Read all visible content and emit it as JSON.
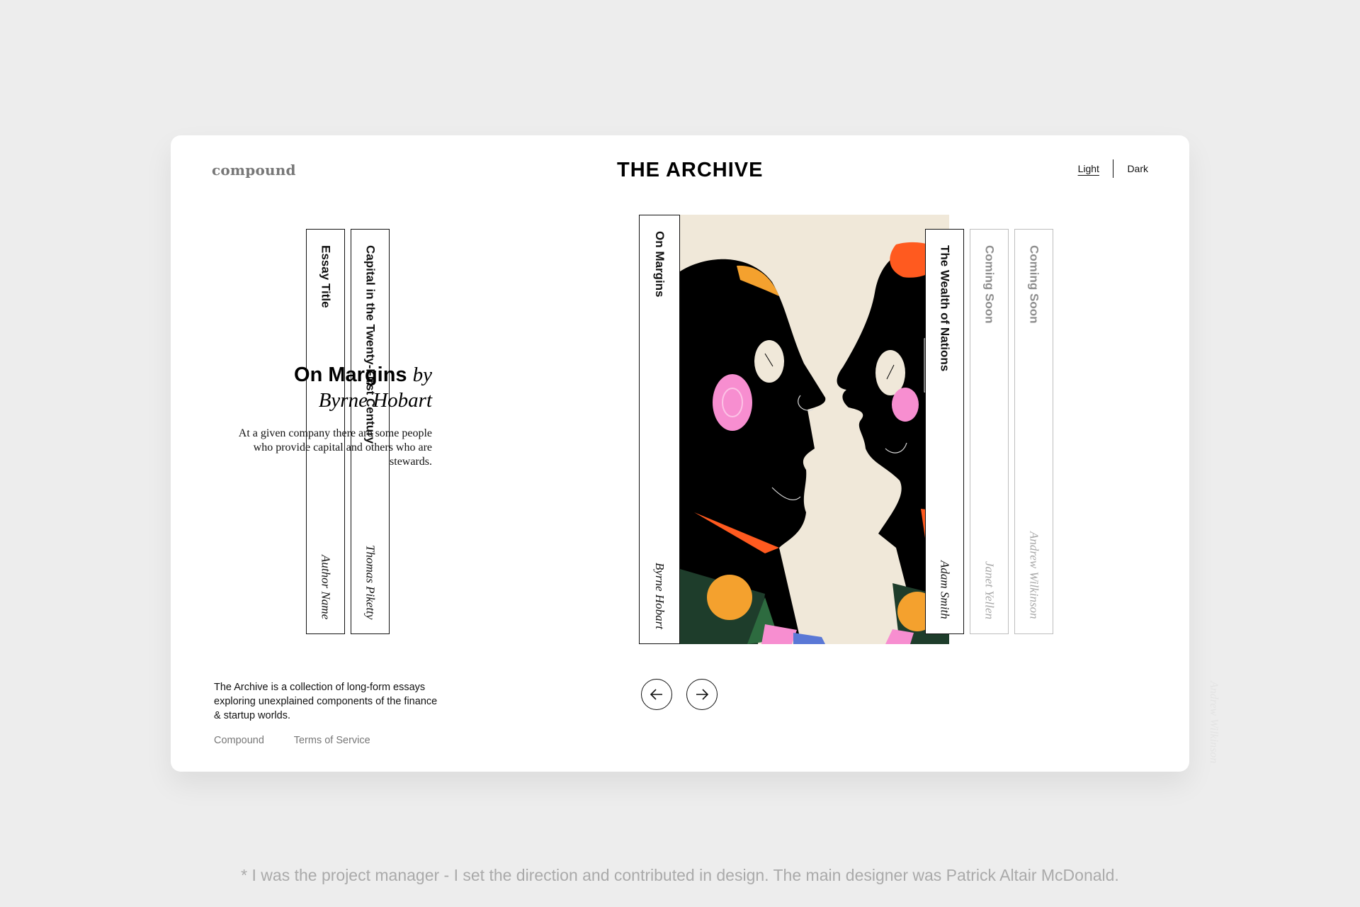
{
  "header": {
    "brand": "compound",
    "title": "THE ARCHIVE",
    "theme": {
      "light_label": "Light",
      "dark_label": "Dark",
      "selected": "Light"
    }
  },
  "shelf_left": [
    {
      "title": "Essay Title",
      "author": "Author Name"
    },
    {
      "title": "Capital in the Twenty-First Century",
      "author": "Thomas Piketty"
    }
  ],
  "featured": {
    "title": "On Margins",
    "by": "by",
    "author": "Byrne Hobart",
    "description": "At a given company there are some people who provide capital and others who are stewards.",
    "spine_title": "On Margins",
    "spine_author": "Byrne Hobart"
  },
  "shelf_right": [
    {
      "title": "The Wealth of Nations",
      "author": "Adam Smith",
      "status": "available"
    },
    {
      "title": "Coming Soon",
      "author": "Janet Yellen",
      "status": "coming-soon"
    },
    {
      "title": "Coming Soon",
      "author": "Andrew Wilkinson",
      "status": "coming-soon"
    }
  ],
  "ghost_author": "Andrew Wilkinson",
  "navigation": {
    "prev_icon": "arrow-left-icon",
    "next_icon": "arrow-right-icon"
  },
  "about": "The Archive is a collection of long-form essays exploring unexplained components of the finance & startup worlds.",
  "footer": {
    "links": [
      "Compound",
      "Terms of Service"
    ]
  },
  "caption": "* I was the project manager - I set the direction and contributed in design. The main designer was Patrick Altair McDonald.",
  "colors": {
    "background": "#ededed",
    "card": "#ffffff",
    "ink": "#111111",
    "muted": "#8e8e8e",
    "cover_bg": "#f0e8d9",
    "accent_orange": "#ff5a1f",
    "accent_pink": "#f78ed0"
  }
}
